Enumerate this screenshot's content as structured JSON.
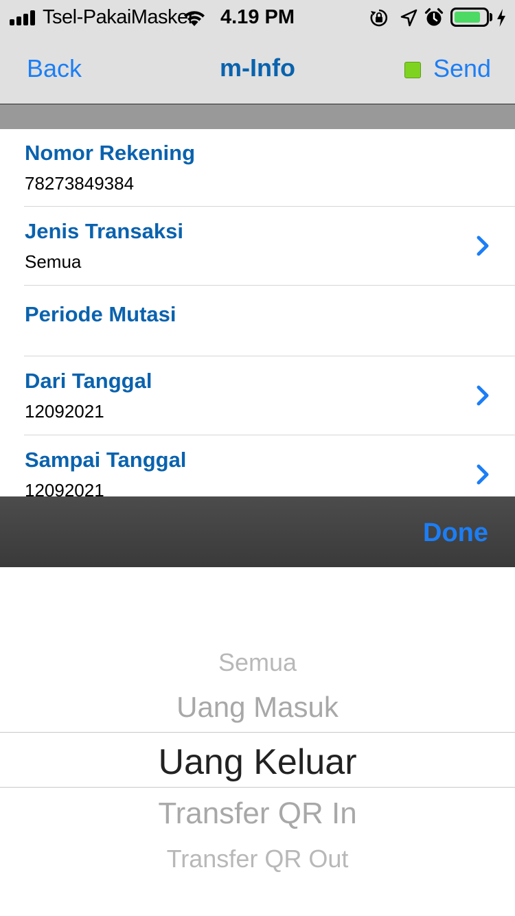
{
  "status_bar": {
    "carrier": "Tsel-PakaiMasker",
    "time": "4.19 PM",
    "icons": [
      "signal-icon",
      "wifi-icon",
      "orientation-lock-icon",
      "location-arrow-icon",
      "alarm-icon",
      "battery-icon",
      "charging-bolt-icon"
    ],
    "battery_level": 0.85
  },
  "nav": {
    "back": "Back",
    "title": "m-Info",
    "send": "Send",
    "send_indicator_color": "#7ed321"
  },
  "form": {
    "rows": [
      {
        "label": "Nomor Rekening",
        "value": "78273849384"
      },
      {
        "label": "Jenis Transaksi",
        "value": "Semua"
      },
      {
        "label": "Periode Mutasi"
      },
      {
        "label": "Dari Tanggal",
        "value": "12092021"
      },
      {
        "label": "Sampai Tanggal",
        "value": "12092021"
      }
    ]
  },
  "picker": {
    "done": "Done",
    "options": [
      "Semua",
      "Uang Masuk",
      "Uang Keluar",
      "Transfer QR In",
      "Transfer QR Out"
    ],
    "selected": "Uang Keluar"
  },
  "colors": {
    "accent": "#1c7ef5",
    "label": "#0a62ae",
    "nav_background": "#e0e0e0",
    "toolbar": "#424242"
  }
}
